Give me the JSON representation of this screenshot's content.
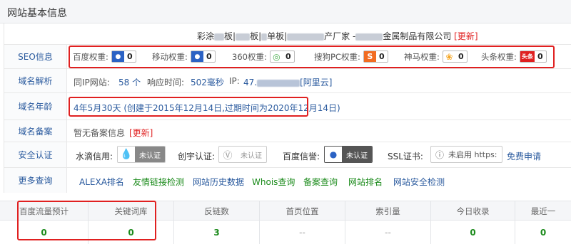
{
  "header": {
    "title": "网站基本信息"
  },
  "company": {
    "prefix": "彩涂",
    "part1": "板|",
    "part2": "板|",
    "part3": "单板|",
    "part4": "产厂家 -",
    "suffix": "金属制品有限公司",
    "update": "[更新]"
  },
  "seo": {
    "label": "SEO信息",
    "items": [
      {
        "name": "百度权重:",
        "value": "0",
        "icon": "paw-icon",
        "color": "#2b62c4"
      },
      {
        "name": "移动权重:",
        "value": "0",
        "icon": "paw-icon",
        "color": "#2b62c4"
      },
      {
        "name": "360权重:",
        "value": "0",
        "icon": "ring-icon",
        "color": "#4caf50"
      },
      {
        "name": "搜狗PC权重:",
        "value": "0",
        "icon": "sogou-icon",
        "color": "#f26c22"
      },
      {
        "name": "神马权重:",
        "value": "0",
        "icon": "shenma-icon",
        "color": "#f5a623"
      },
      {
        "name": "头条权重:",
        "value": "0",
        "icon": "toutiao-icon",
        "color": "#e02020",
        "icon_text": "头条"
      }
    ]
  },
  "dns": {
    "label": "域名解析",
    "same_ip_label": "同IP网站:",
    "same_ip_value": "58 个",
    "response_label": "响应时间:",
    "response_value": "502毫秒",
    "ip_label": "IP:",
    "ip_value": "47.",
    "ip_provider": "[阿里云]"
  },
  "age": {
    "label": "域名年龄",
    "value": "4年5月30天 (创建于2015年12月14日,过期时间为2020年12月14日)"
  },
  "icp": {
    "label": "域名备案",
    "value": "暂无备案信息",
    "update": "[更新]"
  },
  "security": {
    "label": "安全认证",
    "shuidi_label": "水滴信用:",
    "shuidi_badge": "未认证",
    "chuangyu_label": "创宇认证:",
    "chuangyu_badge": "未认证",
    "baidu_label": "百度信誉:",
    "baidu_badge": "未认证",
    "ssl_label": "SSL证书:",
    "ssl_badge": "未启用 https:",
    "ssl_apply": "免费申请"
  },
  "more": {
    "label": "更多查询",
    "links": [
      "ALEXA排名",
      "友情链接检测",
      "网站历史数据",
      "Whois查询",
      "备案查询",
      "网站排名",
      "网站安全检测"
    ]
  },
  "stats": {
    "columns": [
      {
        "header": "百度流量预计",
        "value": "0"
      },
      {
        "header": "关键词库",
        "value": "0"
      },
      {
        "header": "反链数",
        "value": "3"
      },
      {
        "header": "首页位置",
        "value": "--"
      },
      {
        "header": "索引量",
        "value": "--"
      },
      {
        "header": "今日收录",
        "value": "0"
      },
      {
        "header": "最近一",
        "value": "0"
      }
    ]
  }
}
